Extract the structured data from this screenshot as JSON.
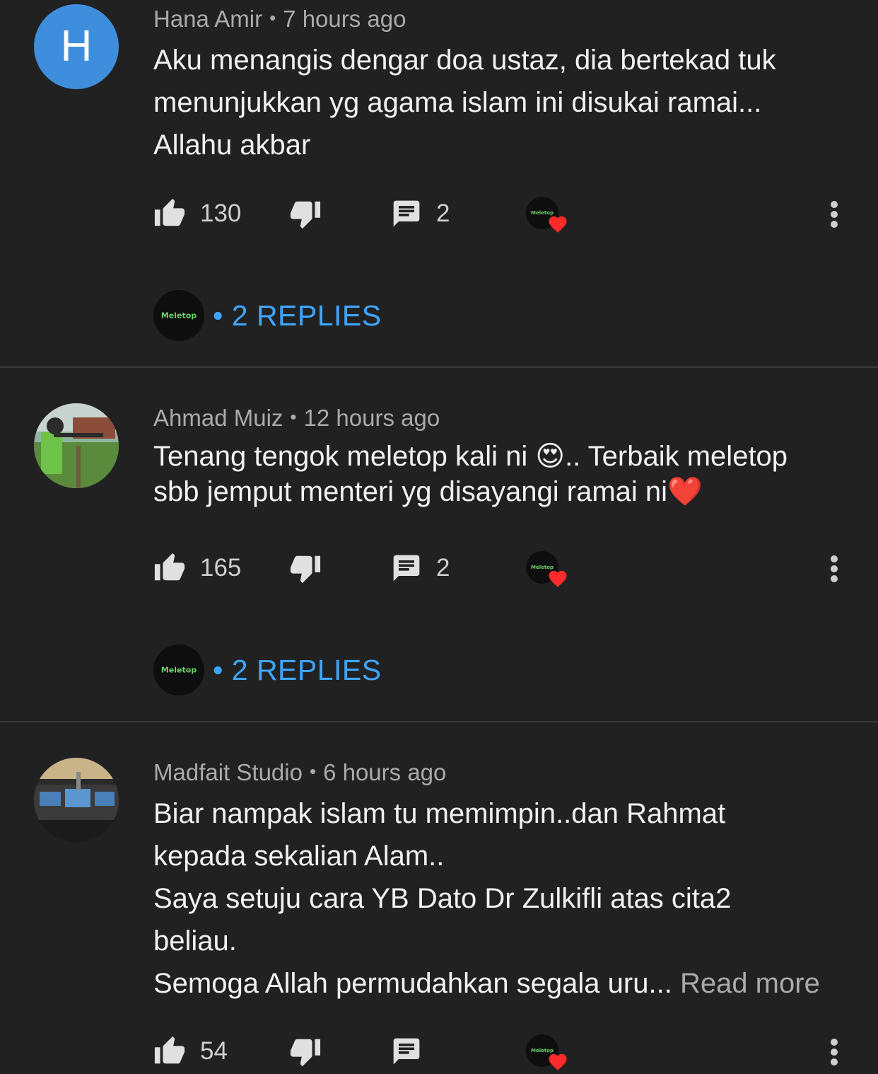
{
  "comments": [
    {
      "author": "Hana Amir",
      "time": "7 hours ago",
      "avatar_letter": "H",
      "avatar_color": "#3f8ede",
      "lines": [
        "Aku menangis dengar doa ustaz, dia bertekad tuk",
        "menunjukkan yg agama islam ini  disukai ramai...",
        "Allahu akbar"
      ],
      "likes": "130",
      "reply_count": "2",
      "replies_label": "• 2 REPLIES",
      "logo_text": "Meletop"
    },
    {
      "author": "Ahmad Muiz",
      "time": "12 hours ago",
      "text_part1": "Tenang tengok meletop kali ni ",
      "emoji1": "😍",
      "text_part2": ".. Terbaik meletop",
      "line2": "sbb jemput menteri yg disayangi ramai ni",
      "emoji2": "❤️",
      "likes": "165",
      "reply_count": "2",
      "replies_label": "• 2 REPLIES",
      "logo_text": "Meletop"
    },
    {
      "author": "Madfait Studio",
      "time": "6 hours ago",
      "lines": [
        "Biar nampak islam tu memimpin..dan Rahmat",
        "kepada sekalian Alam..",
        "Saya setuju cara YB Dato Dr Zulkifli atas cita2",
        "beliau."
      ],
      "last_line": "Semoga Allah permudahkan segala uru...",
      "read_more": "Read more",
      "likes": "54",
      "logo_text": "Meletop"
    }
  ],
  "meta_separator": "•",
  "colors": {
    "background": "#212121",
    "link": "#3ea6ff",
    "heart": "#ff2a2a",
    "secondary_text": "#aaaaaa"
  }
}
